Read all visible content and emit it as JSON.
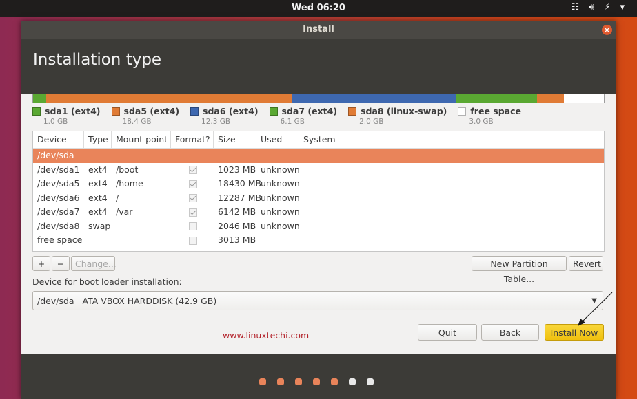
{
  "topbar": {
    "clock": "Wed 06:20",
    "icons": [
      "network-icon",
      "volume-icon",
      "battery-icon",
      "system-menu-icon"
    ]
  },
  "window": {
    "title": "Install",
    "heading": "Installation type"
  },
  "colors": {
    "ext4": "#5aa832",
    "ext4_orange": "#e07b35",
    "ext4_blue": "#3e68b0",
    "swap": "#e07b35",
    "free": "#ffffff",
    "accent": "#e9845a",
    "primary_button": "#f0c10f"
  },
  "partition_bar": [
    {
      "color": "#5aa832",
      "share": 1.0
    },
    {
      "color": "#e07b35",
      "share": 18.4
    },
    {
      "color": "#3e68b0",
      "share": 12.3
    },
    {
      "color": "#5aa832",
      "share": 6.1
    },
    {
      "color": "#e07b35",
      "share": 2.0
    },
    {
      "color": "#ffffff",
      "share": 3.0
    }
  ],
  "legend": [
    {
      "name": "sda1 (ext4)",
      "size": "1.0 GB",
      "color": "#5aa832"
    },
    {
      "name": "sda5 (ext4)",
      "size": "18.4 GB",
      "color": "#e07b35"
    },
    {
      "name": "sda6 (ext4)",
      "size": "12.3 GB",
      "color": "#3e68b0"
    },
    {
      "name": "sda7 (ext4)",
      "size": "6.1 GB",
      "color": "#5aa832"
    },
    {
      "name": "sda8 (linux-swap)",
      "size": "2.0 GB",
      "color": "#e07b35"
    },
    {
      "name": "free space",
      "size": "3.0 GB",
      "color": "#ffffff"
    }
  ],
  "table": {
    "headers": [
      "Device",
      "Type",
      "Mount point",
      "Format?",
      "Size",
      "Used",
      "System"
    ],
    "device_row": "/dev/sda",
    "rows": [
      {
        "device": "/dev/sda1",
        "type": "ext4",
        "mount": "/boot",
        "format": true,
        "size": "1023 MB",
        "used": "unknown",
        "system": ""
      },
      {
        "device": "/dev/sda5",
        "type": "ext4",
        "mount": "/home",
        "format": true,
        "size": "18430 MB",
        "used": "unknown",
        "system": ""
      },
      {
        "device": "/dev/sda6",
        "type": "ext4",
        "mount": "/",
        "format": true,
        "size": "12287 MB",
        "used": "unknown",
        "system": ""
      },
      {
        "device": "/dev/sda7",
        "type": "ext4",
        "mount": "/var",
        "format": true,
        "size": "6142 MB",
        "used": "unknown",
        "system": ""
      },
      {
        "device": "/dev/sda8",
        "type": "swap",
        "mount": "",
        "format": false,
        "size": "2046 MB",
        "used": "unknown",
        "system": ""
      },
      {
        "device": "free space",
        "type": "",
        "mount": "",
        "format": false,
        "size": "3013 MB",
        "used": "",
        "system": ""
      }
    ]
  },
  "toolbar": {
    "add": "+",
    "remove": "−",
    "change": "Change...",
    "new_table": "New Partition Table...",
    "revert": "Revert"
  },
  "bootloader": {
    "label": "Device for boot loader installation:",
    "selected": "/dev/sda   ATA VBOX HARDDISK (42.9 GB)"
  },
  "watermark": "www.linuxtechi.com",
  "actions": {
    "quit": "Quit",
    "back": "Back",
    "install": "Install Now"
  },
  "progress_dots": {
    "total": 7,
    "completed": 5,
    "done_color": "#e9845a",
    "todo_color": "#e8e8e8"
  }
}
